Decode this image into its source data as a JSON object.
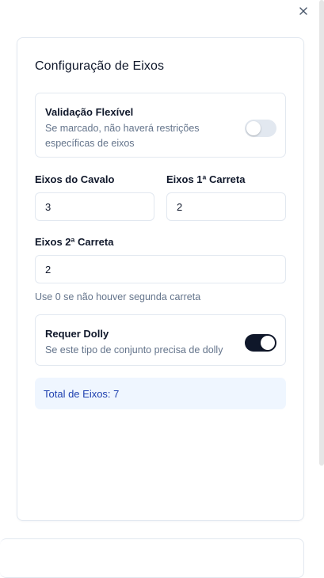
{
  "close_icon": "close-icon",
  "card": {
    "title": "Configuração de Eixos",
    "flexible": {
      "title": "Validação Flexível",
      "description": "Se marcado, não haverá restrições específicas de eixos",
      "checked": false
    },
    "fields": {
      "cavalo": {
        "label": "Eixos do Cavalo",
        "value": "3"
      },
      "carreta1": {
        "label": "Eixos 1ª Carreta",
        "value": "2"
      },
      "carreta2": {
        "label": "Eixos 2ª Carreta",
        "value": "2",
        "hint": "Use 0 se não houver segunda carreta"
      }
    },
    "dolly": {
      "title": "Requer Dolly",
      "description": "Se este tipo de conjunto precisa de dolly",
      "checked": true
    },
    "total": "Total de Eixos: 7"
  },
  "colors": {
    "primary": "#0f172a",
    "muted": "#64748b",
    "border": "#e2e8f0",
    "total_bg": "#eff6ff",
    "total_text": "#1e40af"
  }
}
